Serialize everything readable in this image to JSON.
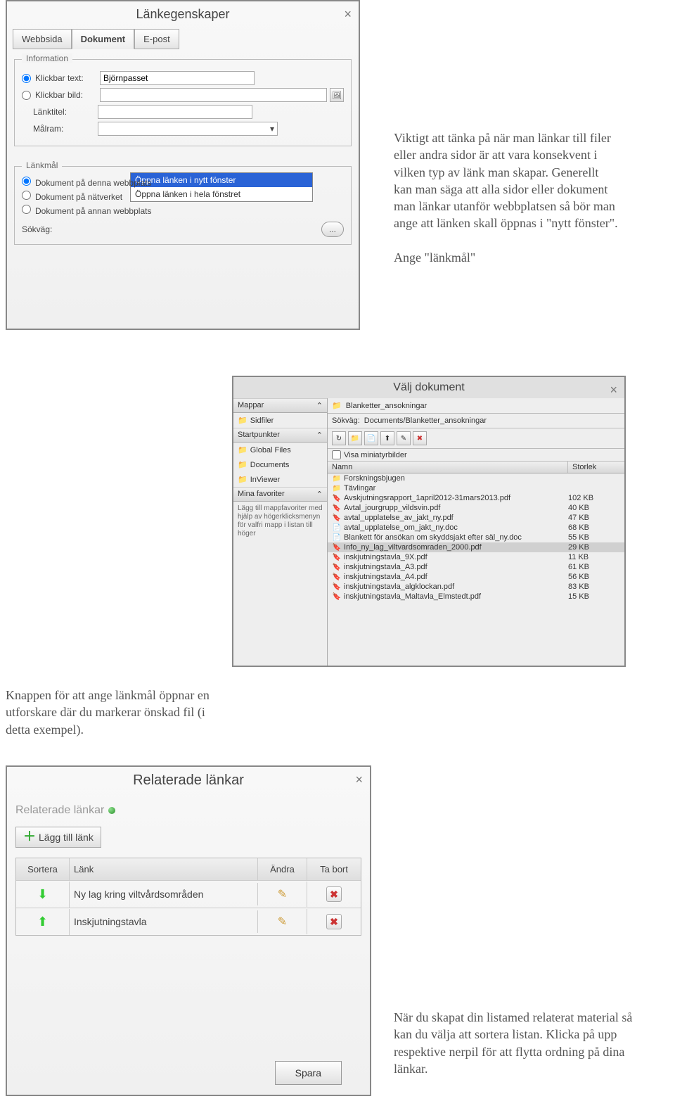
{
  "dialog1": {
    "title": "Länkegenskaper",
    "tabs": {
      "web": "Webbsida",
      "doc": "Dokument",
      "email": "E-post"
    },
    "information": {
      "legend": "Information",
      "klickbar_text_label": "Klickbar text:",
      "klickbar_text_value": "Björnpasset",
      "klickbar_bild_label": "Klickbar bild:",
      "lanktitel_label": "Länktitel:",
      "malram_label": "Målram:",
      "dropdown_opts": {
        "opt1": "Öppna länken i nytt fönster",
        "opt2": "Öppna länken i hela fönstret"
      }
    },
    "lankmal": {
      "legend": "Länkmål",
      "r1": "Dokument på denna webbplats",
      "r2": "Dokument på nätverket",
      "r3": "Dokument på annan webbplats",
      "sokvag_label": "Sökväg:"
    }
  },
  "anno1_text": "Viktigt att tänka på när man länkar till filer eller andra sidor är att vara konsekvent i vilken typ av länk man skapar. Generellt kan man säga att alla sidor eller dokument man länkar utanför webbplatsen så bör man ange att länken skall öppnas i \"nytt fönster\".",
  "anno1_extra": "Ange \"länkmål\"",
  "dialog2": {
    "title": "Välj dokument",
    "side": {
      "mappar": "Mappar",
      "sidfiler": "Sidfiler",
      "startpunkter": "Startpunkter",
      "global": "Global Files",
      "documents": "Documents",
      "inviewer": "InViewer",
      "fav_header": "Mina favoriter",
      "fav_text": "Lägg till mappfavoriter med hjälp av högerklicksmenyn för valfri mapp i listan till höger"
    },
    "crumb_folder": "Blanketter_ansokningar",
    "sokvag_label": "Sökväg:",
    "sokvag_value": "Documents/Blanketter_ansokningar",
    "thumb_label": "Visa miniatyrbilder",
    "col_name": "Namn",
    "col_size": "Storlek",
    "files": [
      {
        "icon": "folder",
        "name": "Forskningsbjugen",
        "size": ""
      },
      {
        "icon": "folder",
        "name": "Tävlingar",
        "size": ""
      },
      {
        "icon": "pdf",
        "name": "Avskjutningsrapport_1april2012-31mars2013.pdf",
        "size": "102 KB"
      },
      {
        "icon": "pdf",
        "name": "Avtal_jourgrupp_vildsvin.pdf",
        "size": "40 KB"
      },
      {
        "icon": "pdf",
        "name": "avtal_upplatelse_av_jakt_ny.pdf",
        "size": "47 KB"
      },
      {
        "icon": "doc",
        "name": "avtal_upplatelse_om_jakt_ny.doc",
        "size": "68 KB"
      },
      {
        "icon": "doc",
        "name": "Blankett för ansökan om skyddsjakt efter säl_ny.doc",
        "size": "55 KB"
      },
      {
        "icon": "pdf",
        "name": "Info_ny_lag_viltvardsomraden_2000.pdf",
        "size": "29 KB",
        "sel": true
      },
      {
        "icon": "pdf",
        "name": "inskjutningstavla_9X.pdf",
        "size": "11 KB"
      },
      {
        "icon": "pdf",
        "name": "inskjutningstavla_A3.pdf",
        "size": "61 KB"
      },
      {
        "icon": "pdf",
        "name": "inskjutningstavla_A4.pdf",
        "size": "56 KB"
      },
      {
        "icon": "pdf",
        "name": "inskjutningstavla_algklockan.pdf",
        "size": "83 KB"
      },
      {
        "icon": "pdf",
        "name": "inskjutningstavla_Maltavla_Elmstedt.pdf",
        "size": "15 KB"
      }
    ]
  },
  "anno2_text": "Knappen för att ange länkmål öppnar en utforskare där du markerar önskad fil (i detta exempel).",
  "dialog3": {
    "title": "Relaterade länkar",
    "subtitle": "Relaterade länkar",
    "add_label": "Lägg till länk",
    "cols": {
      "sort": "Sortera",
      "link": "Länk",
      "edit": "Ändra",
      "del": "Ta bort"
    },
    "rows": [
      {
        "dir": "down",
        "name": "Ny lag kring viltvårdsområden"
      },
      {
        "dir": "up",
        "name": "Inskjutningstavla"
      }
    ],
    "save": "Spara"
  },
  "anno3_text": "När du skapat din listamed relaterat material så kan du välja att sortera listan. Klicka på upp respektive nerpil för att flytta ordning på dina länkar."
}
